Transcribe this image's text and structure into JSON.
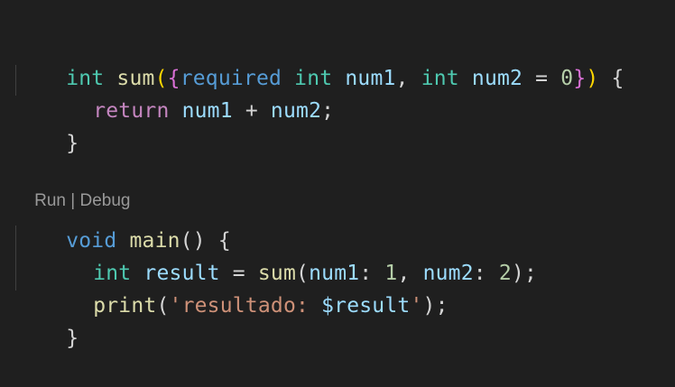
{
  "colors": {
    "background": "#1f1f1f",
    "type_keyword": "#4ec9b0",
    "control_keyword": "#c586c0",
    "keyword": "#569cd6",
    "function": "#dcdcaa",
    "variable": "#9cdcfe",
    "number": "#b5cea8",
    "string": "#ce9178",
    "codelens": "#999999"
  },
  "codelens": {
    "run": "Run",
    "separator": " | ",
    "debug": "Debug"
  },
  "code": {
    "line1": {
      "t1": "int",
      "t2": " ",
      "t3": "sum",
      "t4": "(",
      "t5": "{",
      "t6": "required",
      "t7": " ",
      "t8": "int",
      "t9": " ",
      "t10": "num1",
      "t11": ", ",
      "t12": "int",
      "t13": " ",
      "t14": "num2",
      "t15": " = ",
      "t16": "0",
      "t17": "}",
      "t18": ")",
      "t19": " ",
      "t20": "{"
    },
    "line2": {
      "t1": "return",
      "t2": " ",
      "t3": "num1",
      "t4": " + ",
      "t5": "num2",
      "t6": ";"
    },
    "line3": {
      "t1": "}"
    },
    "line4": {
      "t1": "void",
      "t2": " ",
      "t3": "main",
      "t4": "()",
      "t5": " ",
      "t6": "{"
    },
    "line5": {
      "t1": "int",
      "t2": " ",
      "t3": "result",
      "t4": " = ",
      "t5": "sum",
      "t6": "(",
      "t7": "num1",
      "t8": ": ",
      "t9": "1",
      "t10": ", ",
      "t11": "num2",
      "t12": ": ",
      "t13": "2",
      "t14": ")",
      "t15": ";"
    },
    "line6": {
      "t1": "print",
      "t2": "(",
      "t3": "'resultado: ",
      "t4": "$result",
      "t5": "'",
      "t6": ")",
      "t7": ";"
    },
    "line7": {
      "t1": "}"
    }
  }
}
